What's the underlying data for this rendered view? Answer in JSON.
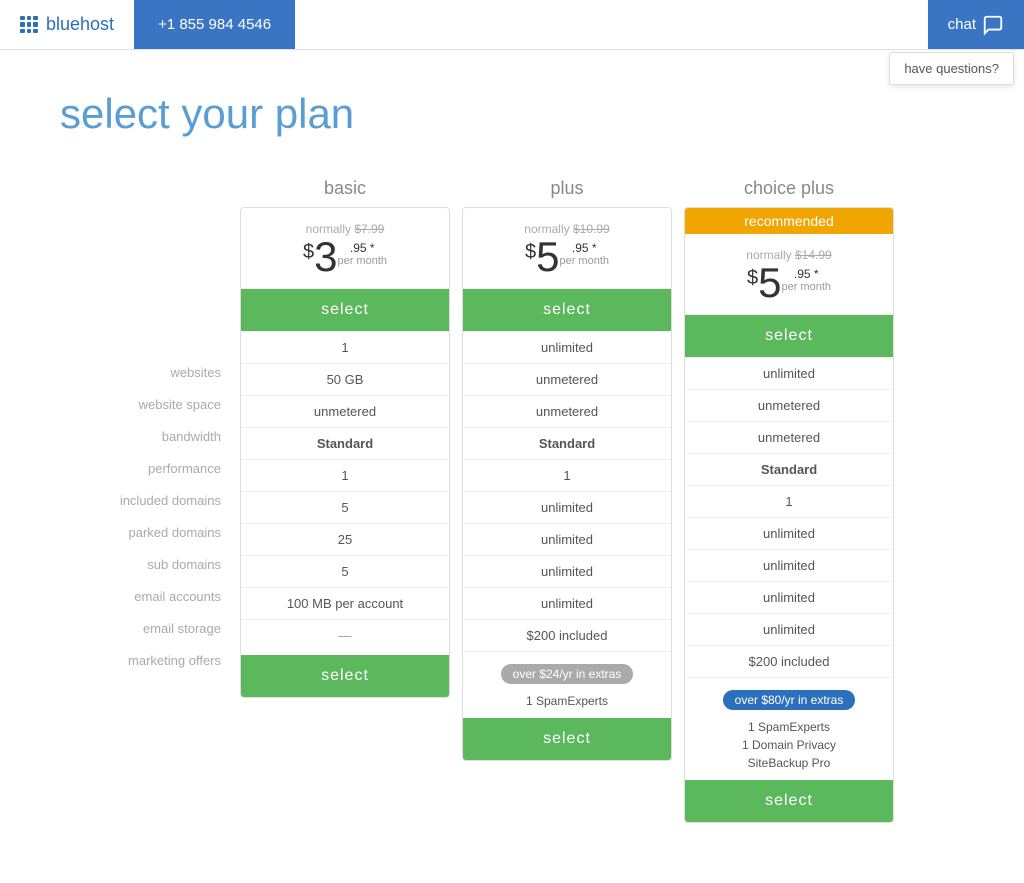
{
  "header": {
    "logo_text": "bluehost",
    "phone": "+1 855 984 4546",
    "chat_label": "chat",
    "have_questions": "have questions?"
  },
  "page": {
    "title": "select your plan"
  },
  "plans": [
    {
      "id": "basic",
      "name": "basic",
      "recommended": false,
      "recommended_label": "",
      "normally_label": "normally",
      "old_price": "$7.99",
      "price_dollar": "$",
      "price_whole": "3",
      "price_decimal": ".95",
      "price_asterisk": "*",
      "per_month": "per month",
      "select_label": "select",
      "features": {
        "websites": "1",
        "website_space": "50 GB",
        "bandwidth": "unmetered",
        "performance": "Standard",
        "included_domains": "1",
        "parked_domains": "5",
        "sub_domains": "25",
        "email_accounts": "5",
        "email_storage": "100 MB per account",
        "marketing_offers": "—"
      },
      "extras": [],
      "extras_badge": null,
      "extras_badge_type": "",
      "extra_items": []
    },
    {
      "id": "plus",
      "name": "plus",
      "recommended": false,
      "recommended_label": "",
      "normally_label": "normally",
      "old_price": "$10.99",
      "price_dollar": "$",
      "price_whole": "5",
      "price_decimal": ".95",
      "price_asterisk": "*",
      "per_month": "per month",
      "select_label": "select",
      "features": {
        "websites": "unlimited",
        "website_space": "unmetered",
        "bandwidth": "unmetered",
        "performance": "Standard",
        "included_domains": "1",
        "parked_domains": "unlimited",
        "sub_domains": "unlimited",
        "email_accounts": "unlimited",
        "email_storage": "unlimited",
        "marketing_offers": "$200 included"
      },
      "extras_badge": "over $24/yr in extras",
      "extras_badge_type": "gray",
      "extra_items": [
        "1 SpamExperts"
      ]
    },
    {
      "id": "choice-plus",
      "name": "choice plus",
      "recommended": true,
      "recommended_label": "recommended",
      "normally_label": "normally",
      "old_price": "$14.99",
      "price_dollar": "$",
      "price_whole": "5",
      "price_decimal": ".95",
      "price_asterisk": "*",
      "per_month": "per month",
      "select_label": "select",
      "features": {
        "websites": "unlimited",
        "website_space": "unmetered",
        "bandwidth": "unmetered",
        "performance": "Standard",
        "included_domains": "1",
        "parked_domains": "unlimited",
        "sub_domains": "unlimited",
        "email_accounts": "unlimited",
        "email_storage": "unlimited",
        "marketing_offers": "$200 included"
      },
      "extras_badge": "over $80/yr in extras",
      "extras_badge_type": "blue",
      "extra_items": [
        "1 SpamExperts",
        "1 Domain Privacy",
        "SiteBackup Pro"
      ]
    }
  ],
  "feature_labels": [
    {
      "key": "websites",
      "label": "websites"
    },
    {
      "key": "website_space",
      "label": "website space"
    },
    {
      "key": "bandwidth",
      "label": "bandwidth"
    },
    {
      "key": "performance",
      "label": "performance"
    },
    {
      "key": "included_domains",
      "label": "included domains"
    },
    {
      "key": "parked_domains",
      "label": "parked domains"
    },
    {
      "key": "sub_domains",
      "label": "sub domains"
    },
    {
      "key": "email_accounts",
      "label": "email accounts"
    },
    {
      "key": "email_storage",
      "label": "email storage"
    },
    {
      "key": "marketing_offers",
      "label": "marketing offers"
    }
  ]
}
